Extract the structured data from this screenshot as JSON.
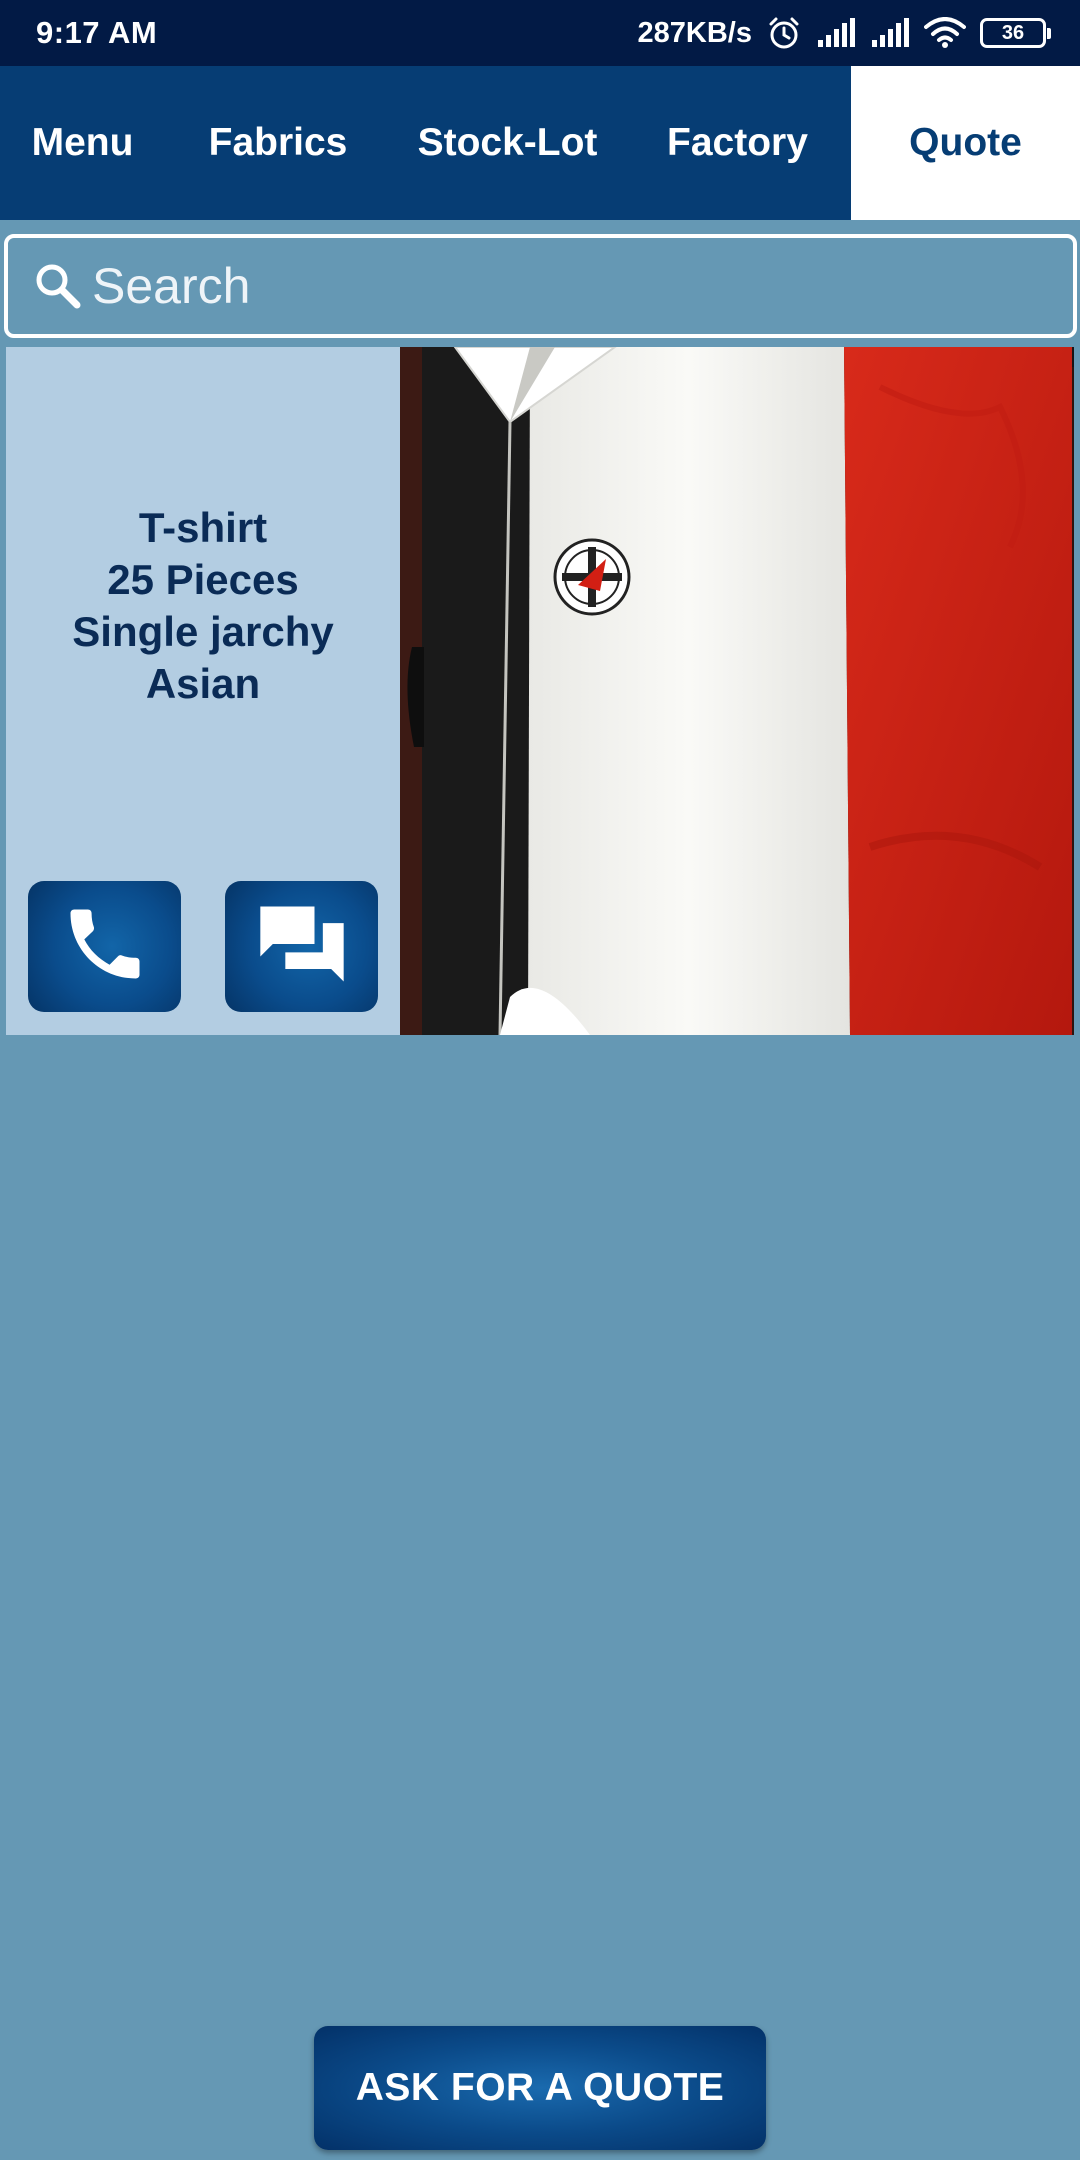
{
  "status_bar": {
    "time": "9:17 AM",
    "network_speed": "287KB/s",
    "battery_level": "36",
    "icons": [
      "alarm-icon",
      "signal-icon",
      "signal-icon",
      "wifi-icon",
      "battery-icon"
    ]
  },
  "nav": {
    "tabs": [
      {
        "label": "Menu",
        "active": false
      },
      {
        "label": "Fabrics",
        "active": false
      },
      {
        "label": "Stock-Lot",
        "active": false
      },
      {
        "label": "Factory",
        "active": false
      },
      {
        "label": "Quote",
        "active": true
      }
    ]
  },
  "search": {
    "placeholder": "Search",
    "value": ""
  },
  "listing": {
    "line1": "T-shirt",
    "line2": "25 Pieces",
    "line3": "Single jarchy",
    "line4": "Asian",
    "call_icon": "phone-icon",
    "chat_icon": "chat-icon"
  },
  "quote_button": {
    "label": "ASK FOR A QUOTE"
  },
  "colors": {
    "status_bar": "#021a45",
    "nav_bar": "#063d74",
    "background": "#6598b4",
    "card_info": "#b3cde2",
    "text_dark": "#0a2b56"
  }
}
